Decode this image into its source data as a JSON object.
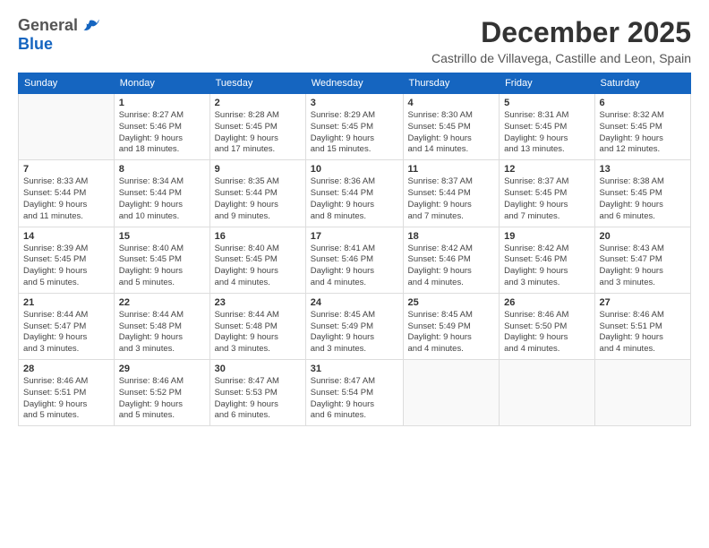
{
  "header": {
    "logo_general": "General",
    "logo_blue": "Blue",
    "month": "December 2025",
    "location": "Castrillo de Villavega, Castille and Leon, Spain"
  },
  "days_of_week": [
    "Sunday",
    "Monday",
    "Tuesday",
    "Wednesday",
    "Thursday",
    "Friday",
    "Saturday"
  ],
  "weeks": [
    [
      {
        "day": "",
        "info": ""
      },
      {
        "day": "1",
        "info": "Sunrise: 8:27 AM\nSunset: 5:46 PM\nDaylight: 9 hours\nand 18 minutes."
      },
      {
        "day": "2",
        "info": "Sunrise: 8:28 AM\nSunset: 5:45 PM\nDaylight: 9 hours\nand 17 minutes."
      },
      {
        "day": "3",
        "info": "Sunrise: 8:29 AM\nSunset: 5:45 PM\nDaylight: 9 hours\nand 15 minutes."
      },
      {
        "day": "4",
        "info": "Sunrise: 8:30 AM\nSunset: 5:45 PM\nDaylight: 9 hours\nand 14 minutes."
      },
      {
        "day": "5",
        "info": "Sunrise: 8:31 AM\nSunset: 5:45 PM\nDaylight: 9 hours\nand 13 minutes."
      },
      {
        "day": "6",
        "info": "Sunrise: 8:32 AM\nSunset: 5:45 PM\nDaylight: 9 hours\nand 12 minutes."
      }
    ],
    [
      {
        "day": "7",
        "info": "Sunrise: 8:33 AM\nSunset: 5:44 PM\nDaylight: 9 hours\nand 11 minutes."
      },
      {
        "day": "8",
        "info": "Sunrise: 8:34 AM\nSunset: 5:44 PM\nDaylight: 9 hours\nand 10 minutes."
      },
      {
        "day": "9",
        "info": "Sunrise: 8:35 AM\nSunset: 5:44 PM\nDaylight: 9 hours\nand 9 minutes."
      },
      {
        "day": "10",
        "info": "Sunrise: 8:36 AM\nSunset: 5:44 PM\nDaylight: 9 hours\nand 8 minutes."
      },
      {
        "day": "11",
        "info": "Sunrise: 8:37 AM\nSunset: 5:44 PM\nDaylight: 9 hours\nand 7 minutes."
      },
      {
        "day": "12",
        "info": "Sunrise: 8:37 AM\nSunset: 5:45 PM\nDaylight: 9 hours\nand 7 minutes."
      },
      {
        "day": "13",
        "info": "Sunrise: 8:38 AM\nSunset: 5:45 PM\nDaylight: 9 hours\nand 6 minutes."
      }
    ],
    [
      {
        "day": "14",
        "info": "Sunrise: 8:39 AM\nSunset: 5:45 PM\nDaylight: 9 hours\nand 5 minutes."
      },
      {
        "day": "15",
        "info": "Sunrise: 8:40 AM\nSunset: 5:45 PM\nDaylight: 9 hours\nand 5 minutes."
      },
      {
        "day": "16",
        "info": "Sunrise: 8:40 AM\nSunset: 5:45 PM\nDaylight: 9 hours\nand 4 minutes."
      },
      {
        "day": "17",
        "info": "Sunrise: 8:41 AM\nSunset: 5:46 PM\nDaylight: 9 hours\nand 4 minutes."
      },
      {
        "day": "18",
        "info": "Sunrise: 8:42 AM\nSunset: 5:46 PM\nDaylight: 9 hours\nand 4 minutes."
      },
      {
        "day": "19",
        "info": "Sunrise: 8:42 AM\nSunset: 5:46 PM\nDaylight: 9 hours\nand 3 minutes."
      },
      {
        "day": "20",
        "info": "Sunrise: 8:43 AM\nSunset: 5:47 PM\nDaylight: 9 hours\nand 3 minutes."
      }
    ],
    [
      {
        "day": "21",
        "info": "Sunrise: 8:44 AM\nSunset: 5:47 PM\nDaylight: 9 hours\nand 3 minutes."
      },
      {
        "day": "22",
        "info": "Sunrise: 8:44 AM\nSunset: 5:48 PM\nDaylight: 9 hours\nand 3 minutes."
      },
      {
        "day": "23",
        "info": "Sunrise: 8:44 AM\nSunset: 5:48 PM\nDaylight: 9 hours\nand 3 minutes."
      },
      {
        "day": "24",
        "info": "Sunrise: 8:45 AM\nSunset: 5:49 PM\nDaylight: 9 hours\nand 3 minutes."
      },
      {
        "day": "25",
        "info": "Sunrise: 8:45 AM\nSunset: 5:49 PM\nDaylight: 9 hours\nand 4 minutes."
      },
      {
        "day": "26",
        "info": "Sunrise: 8:46 AM\nSunset: 5:50 PM\nDaylight: 9 hours\nand 4 minutes."
      },
      {
        "day": "27",
        "info": "Sunrise: 8:46 AM\nSunset: 5:51 PM\nDaylight: 9 hours\nand 4 minutes."
      }
    ],
    [
      {
        "day": "28",
        "info": "Sunrise: 8:46 AM\nSunset: 5:51 PM\nDaylight: 9 hours\nand 5 minutes."
      },
      {
        "day": "29",
        "info": "Sunrise: 8:46 AM\nSunset: 5:52 PM\nDaylight: 9 hours\nand 5 minutes."
      },
      {
        "day": "30",
        "info": "Sunrise: 8:47 AM\nSunset: 5:53 PM\nDaylight: 9 hours\nand 6 minutes."
      },
      {
        "day": "31",
        "info": "Sunrise: 8:47 AM\nSunset: 5:54 PM\nDaylight: 9 hours\nand 6 minutes."
      },
      {
        "day": "",
        "info": ""
      },
      {
        "day": "",
        "info": ""
      },
      {
        "day": "",
        "info": ""
      }
    ]
  ]
}
